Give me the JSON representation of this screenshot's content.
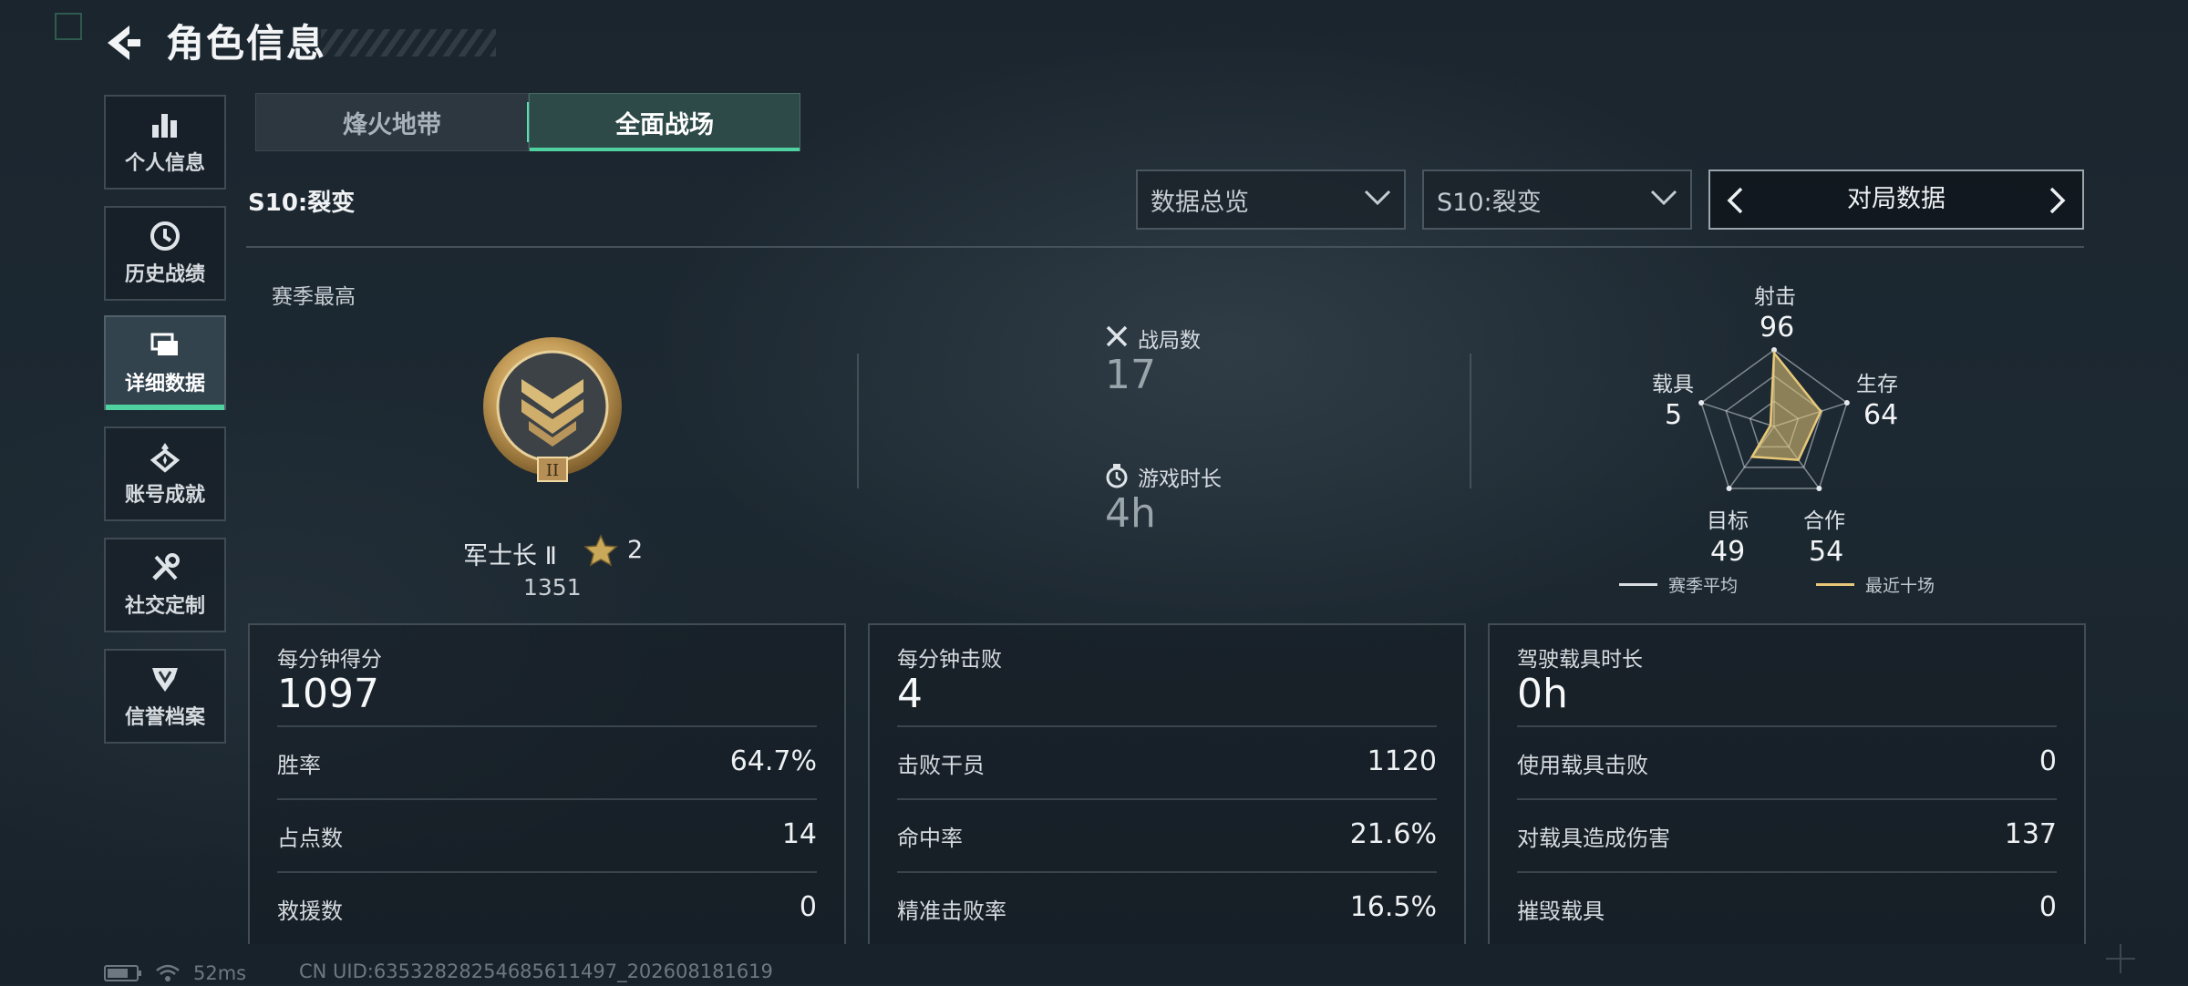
{
  "header": {
    "title": "角色信息"
  },
  "sidebar": {
    "items": [
      {
        "label": "个人信息",
        "icon": "bar-chart-icon"
      },
      {
        "label": "历史战绩",
        "icon": "history-clock-icon"
      },
      {
        "label": "详细数据",
        "icon": "folders-icon",
        "active": true
      },
      {
        "label": "账号成就",
        "icon": "medal-icon"
      },
      {
        "label": "社交定制",
        "icon": "tools-icon"
      },
      {
        "label": "信誉档案",
        "icon": "shield-badge-icon"
      }
    ]
  },
  "tabs": [
    {
      "label": "烽火地带",
      "active": false
    },
    {
      "label": "全面战场",
      "active": true
    }
  ],
  "filters": {
    "season_label": "S10:裂变",
    "data_type": "数据总览",
    "season_select": "S10:裂变",
    "nav_label": "对局数据"
  },
  "best": {
    "label": "赛季最高",
    "rank_name": "军士长 Ⅱ",
    "stars": "2",
    "score": "1351"
  },
  "summary": {
    "matches_label": "战局数",
    "matches_value": "17",
    "playtime_label": "游戏时长",
    "playtime_value": "4h"
  },
  "radar": {
    "axes": [
      {
        "label": "射击",
        "value": "96"
      },
      {
        "label": "生存",
        "value": "64"
      },
      {
        "label": "合作",
        "value": "54"
      },
      {
        "label": "目标",
        "value": "49"
      },
      {
        "label": "载具",
        "value": "5"
      }
    ],
    "legend": {
      "season_avg": "赛季平均",
      "recent": "最近十场"
    },
    "colors": {
      "recent": "#e7c879",
      "season_avg": "#d8dde1"
    }
  },
  "panels": [
    {
      "head_label": "每分钟得分",
      "head_value": "1097",
      "rows": [
        {
          "k": "胜率",
          "v": "64.7%"
        },
        {
          "k": "占点数",
          "v": "14"
        },
        {
          "k": "救援数",
          "v": "0"
        }
      ]
    },
    {
      "head_label": "每分钟击败",
      "head_value": "4",
      "rows": [
        {
          "k": "击败干员",
          "v": "1120"
        },
        {
          "k": "命中率",
          "v": "21.6%"
        },
        {
          "k": "精准击败率",
          "v": "16.5%"
        }
      ]
    },
    {
      "head_label": "驾驶载具时长",
      "head_value": "0h",
      "rows": [
        {
          "k": "使用载具击败",
          "v": "0"
        },
        {
          "k": "对载具造成伤害",
          "v": "137"
        },
        {
          "k": "摧毁载具",
          "v": "0"
        }
      ]
    }
  ],
  "status": {
    "ping": "52ms",
    "uid": "CN UID:63532828254685611497_202608181619"
  },
  "colors": {
    "accent": "#4fd1a0",
    "gold": "#c9a85a"
  }
}
